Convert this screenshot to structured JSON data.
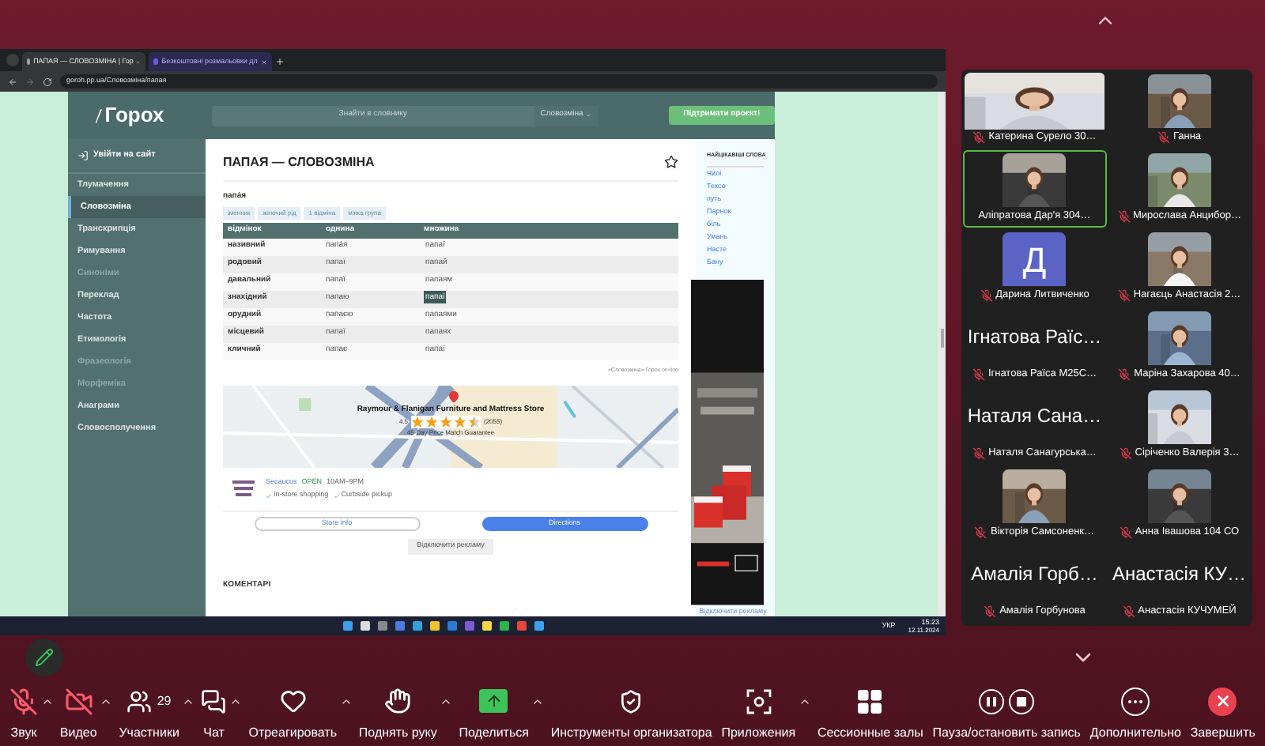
{
  "browser": {
    "tabs": [
      {
        "title": "ПАПАЯ — СЛОВОЗМІНА | Гор",
        "selected": true
      },
      {
        "title": "Безкоштовні розмальовки дл",
        "selected": false
      }
    ],
    "url": "goroh.pp.ua/Словозміна/папая"
  },
  "site": {
    "logo": "Горох",
    "search_placeholder": "Знайти в словнику",
    "search_scope": "Словозміна",
    "support_button": "Підтримати проєкт!",
    "login": "Увійти на сайт",
    "nav": [
      {
        "label": "Тлумачення",
        "selected": false,
        "disabled": false
      },
      {
        "label": "Словозміна",
        "selected": true,
        "disabled": false
      },
      {
        "label": "Транскрипція",
        "selected": false,
        "disabled": false
      },
      {
        "label": "Римування",
        "selected": false,
        "disabled": false
      },
      {
        "label": "Синоніми",
        "selected": false,
        "disabled": true
      },
      {
        "label": "Переклад",
        "selected": false,
        "disabled": false
      },
      {
        "label": "Частота",
        "selected": false,
        "disabled": false
      },
      {
        "label": "Етимологія",
        "selected": false,
        "disabled": false
      },
      {
        "label": "Фразеологія",
        "selected": false,
        "disabled": true
      },
      {
        "label": "Морфеміка",
        "selected": false,
        "disabled": true
      },
      {
        "label": "Анаграми",
        "selected": false,
        "disabled": false
      },
      {
        "label": "Словосполучення",
        "selected": false,
        "disabled": false
      }
    ],
    "title": "ПАПАЯ — СЛОВОЗМІНА",
    "word": "папа́я",
    "tags": [
      "іменник",
      "жіночий рід",
      "1 відміна",
      "м'яка група"
    ],
    "table": {
      "columns": [
        "відмінок",
        "однина",
        "множина"
      ],
      "rows": [
        {
          "case": "називний",
          "singular": "папа́я",
          "plural": "папаї",
          "plural_selected": false
        },
        {
          "case": "родовий",
          "singular": "папаї",
          "plural": "папай",
          "plural_selected": false
        },
        {
          "case": "давальний",
          "singular": "папаї",
          "plural": "папаям",
          "plural_selected": false
        },
        {
          "case": "знахідний",
          "singular": "папаю",
          "plural": "папаї",
          "plural_selected": true
        },
        {
          "case": "орудний",
          "singular": "папаєю",
          "plural": "папаями",
          "plural_selected": false
        },
        {
          "case": "місцевий",
          "singular": "папаї",
          "plural": "папаях",
          "plural_selected": false
        },
        {
          "case": "кличний",
          "singular": "папає",
          "plural": "папаї",
          "plural_selected": false
        }
      ]
    },
    "source": "«Словозміна» Горох on-line",
    "map_ad": {
      "store": "Raymour & Flanigan Furniture and Mattress Store",
      "rating": "4.5",
      "stars": 4.5,
      "reviews": "(2055)",
      "promo": "45-Day Price Match Guarantee",
      "city": "Secaucus",
      "status": "OPEN",
      "hours": "10AM–9PM",
      "features": [
        "In-store shopping",
        "Curbside pickup"
      ],
      "store_info": "Store info",
      "directions": "Directions"
    },
    "disable_ads": "Відключити рекламу",
    "comments": "КОМЕНТАРІ",
    "interesting": {
      "title": "НАЙЦІКАВІШІ СЛОВА",
      "words": [
        "Чилі",
        "Тексо",
        "путь",
        "Парнок",
        "біль",
        "Умань",
        "Насте",
        "Бану"
      ]
    },
    "side_disable_ads": "Відключити рекламу"
  },
  "taskbar": {
    "language": "УКР",
    "time": "15:23",
    "date": "12.11.2024"
  },
  "participants": [
    {
      "name": "Катерина Сурело 30…",
      "kind": "video_full",
      "muted": true,
      "speaking": false
    },
    {
      "name": "Ганна",
      "kind": "video",
      "muted": true,
      "speaking": false
    },
    {
      "name": "Аліпратова Дар'я 304…",
      "kind": "video",
      "muted": false,
      "speaking": true
    },
    {
      "name": "Мирослава Анцибор…",
      "kind": "video",
      "muted": true,
      "speaking": false
    },
    {
      "name": "Дарина Литвиченко",
      "kind": "avatar",
      "initial": "Д",
      "muted": true,
      "speaking": false
    },
    {
      "name": "Нагаєць Анастасія 2…",
      "kind": "video",
      "muted": true,
      "speaking": false
    },
    {
      "name": "Ігнатова Раїса М25С…",
      "kind": "name_only",
      "display_name": "Ігнатова Раїс…",
      "muted": true,
      "speaking": false
    },
    {
      "name": "Маріна Захарова 40…",
      "kind": "video",
      "muted": true,
      "speaking": false
    },
    {
      "name": "Наталя Санагурська…",
      "kind": "name_only",
      "display_name": "Наталя Сана…",
      "muted": true,
      "speaking": false
    },
    {
      "name": "Сіріченко Валерія 3…",
      "kind": "video",
      "muted": true,
      "speaking": false
    },
    {
      "name": "Вікторія Самсоненк…",
      "kind": "video",
      "muted": true,
      "speaking": false
    },
    {
      "name": "Анна Івашова 104 СО",
      "kind": "video",
      "muted": true,
      "speaking": false
    },
    {
      "name": "Амалія Горбунова",
      "kind": "name_only",
      "display_name": "Амалія Горб…",
      "muted": true,
      "speaking": false
    },
    {
      "name": "Анастасія КУЧУМЕЙ",
      "kind": "name_only",
      "display_name": "Анастасія КУ…",
      "muted": true,
      "speaking": false
    }
  ],
  "toolbar": [
    {
      "kind": "audio",
      "label": "Звук",
      "off": true,
      "caret": true
    },
    {
      "kind": "video",
      "label": "Видео",
      "off": true,
      "caret": true
    },
    {
      "kind": "participants",
      "label": "Участники",
      "count": "29",
      "caret": true
    },
    {
      "kind": "chat",
      "label": "Чат",
      "caret": true
    },
    {
      "kind": "react",
      "label": "Отреагировать",
      "caret": true
    },
    {
      "kind": "raise_hand",
      "label": "Поднять руку",
      "caret": true
    },
    {
      "kind": "share",
      "label": "Поделиться",
      "caret": true
    },
    {
      "kind": "host_tools",
      "label": "Инструменты организатора",
      "caret": false
    },
    {
      "kind": "apps",
      "label": "Приложения",
      "caret": true
    },
    {
      "kind": "breakout",
      "label": "Сессионные залы",
      "caret": false
    },
    {
      "kind": "record",
      "label": "Пауза/остановить запись",
      "caret": false
    },
    {
      "kind": "more",
      "label": "Дополнительно",
      "caret": false
    },
    {
      "kind": "end",
      "label": "Завершить",
      "caret": false
    }
  ]
}
